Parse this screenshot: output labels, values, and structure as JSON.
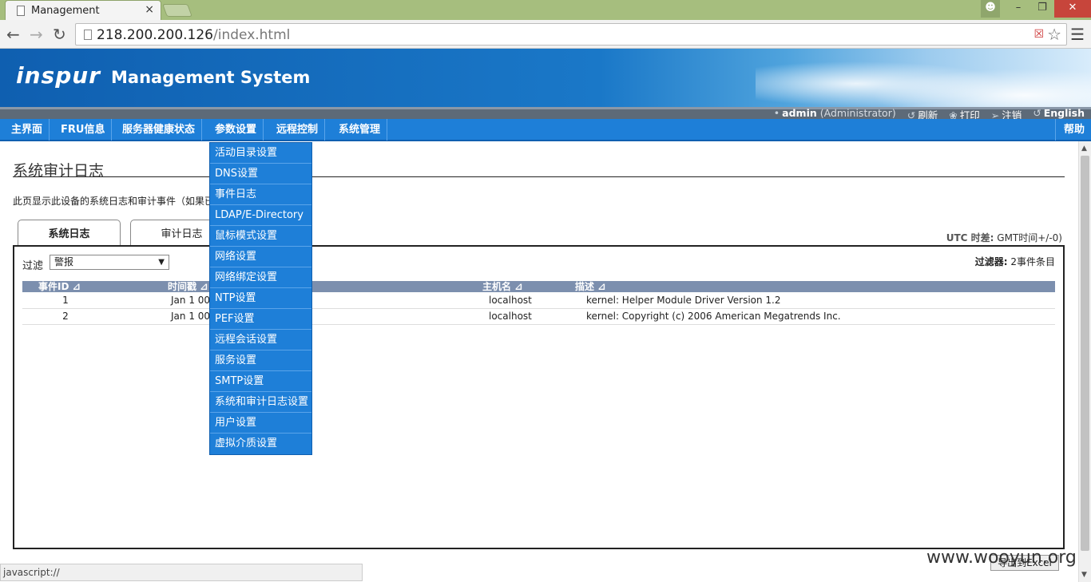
{
  "browser": {
    "tab_title": "Management",
    "tab_close": "×",
    "url_host": "218.200.200.126",
    "url_path": "/index.html",
    "status_text": "javascript://"
  },
  "header": {
    "logo_text": "inspur",
    "system_title": "Management System"
  },
  "userbar": {
    "username": "admin",
    "role": "(Administrator)",
    "refresh": "刷新",
    "print": "打印",
    "logout": "注销",
    "language": "English"
  },
  "nav": {
    "items": [
      "主界面",
      "FRU信息",
      "服务器健康状态",
      "参数设置",
      "远程控制",
      "系统管理"
    ],
    "help": "帮助"
  },
  "dropdown": {
    "items": [
      "活动目录设置",
      "DNS设置",
      "事件日志",
      "LDAP/E-Directory",
      "鼠标模式设置",
      "网络设置",
      "网络绑定设置",
      "NTP设置",
      "PEF设置",
      "远程会话设置",
      "服务设置",
      "SMTP设置",
      "系统和审计日志设置",
      "用户设置",
      "虚拟介质设置"
    ]
  },
  "page": {
    "title": "系统审计日志",
    "description": "此页显示此设备的系统日志和审计事件（如果已",
    "tabs": [
      "系统日志",
      "审计日志"
    ],
    "utc_label": "UTC 时差:",
    "utc_value": "GMT时间+/-0)",
    "filter_label": "过滤",
    "filter_value": "警报",
    "filter_count_label": "过滤器:",
    "filter_count_value": "2事件条目",
    "export_label": "导出到Excel"
  },
  "table": {
    "headers": [
      "事件ID",
      "时间戳",
      "主机名",
      "描述"
    ],
    "rows": [
      {
        "id": "1",
        "time": "Jan 1 00",
        "host": "localhost",
        "desc": "kernel: Helper Module Driver Version 1.2"
      },
      {
        "id": "2",
        "time": "Jan 1 00",
        "host": "localhost",
        "desc": "kernel: Copyright (c) 2006 American Megatrends Inc."
      }
    ]
  },
  "watermark": "www.wooyun.org"
}
